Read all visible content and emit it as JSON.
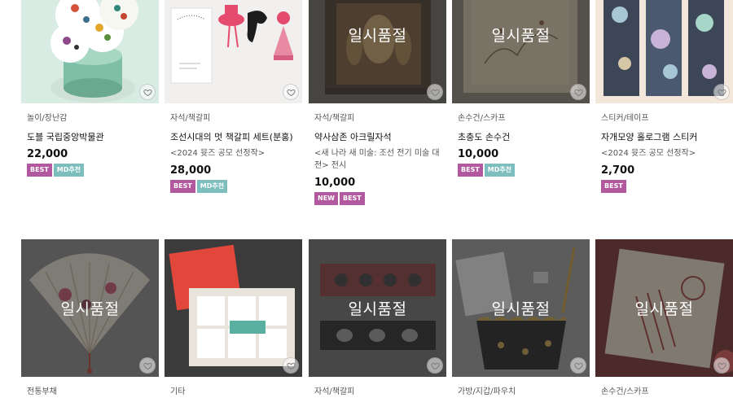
{
  "sold_out_label": "일시품절",
  "colors": {
    "best": "#b1589e",
    "md": "#7cbdbd",
    "new": "#b1589e",
    "overlay": "rgba(40,40,40,0.55)"
  },
  "row1": [
    {
      "category": "놀이/장난감",
      "name": "도블 국립중앙박물관",
      "subtitle": "",
      "price": "22,000",
      "badges": [
        "BEST",
        "MD추천"
      ],
      "sold_out": false
    },
    {
      "category": "자석/책갈피",
      "name": "조선시대의 멋 책갈피 세트(분홍)",
      "subtitle": "<2024 뮷즈 공모 선정작>",
      "price": "28,000",
      "badges": [
        "BEST",
        "MD추천"
      ],
      "sold_out": false
    },
    {
      "category": "자석/책갈피",
      "name": "약사삼존 아크릴자석",
      "subtitle": "<새 나라 새 미술: 조선 전기 미술 대전> 전시",
      "price": "10,000",
      "badges": [
        "NEW",
        "BEST"
      ],
      "sold_out": true
    },
    {
      "category": "손수건/스카프",
      "name": "초충도 손수건",
      "subtitle": "",
      "price": "10,000",
      "badges": [
        "BEST",
        "MD추천"
      ],
      "sold_out": true
    },
    {
      "category": "스티커/테이프",
      "name": "자개모양 홀로그램 스티커",
      "subtitle": "<2024 뮷즈 공모 선정작>",
      "price": "2,700",
      "badges": [
        "BEST"
      ],
      "sold_out": false
    }
  ],
  "row2": [
    {
      "category": "전통부채",
      "sold_out": true
    },
    {
      "category": "기타",
      "sold_out": false
    },
    {
      "category": "자석/책갈피",
      "sold_out": true
    },
    {
      "category": "가방/지갑/파우치",
      "sold_out": true
    },
    {
      "category": "손수건/스카프",
      "sold_out": true
    }
  ]
}
